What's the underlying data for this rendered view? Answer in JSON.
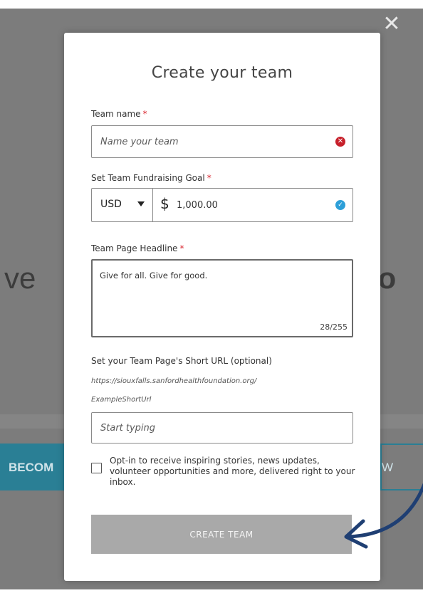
{
  "background": {
    "headline_left": "ve",
    "headline_right": "go",
    "button_left": "BECOM",
    "button_right": "W"
  },
  "modal": {
    "close_symbol": "✕",
    "title": "Create your team",
    "team_name": {
      "label": "Team name",
      "required_marker": "*",
      "placeholder": "Name your team",
      "status_icon": "error-icon",
      "status_symbol": "✕"
    },
    "goal": {
      "label": "Set Team Fundraising Goal",
      "required_marker": "*",
      "currency": "USD",
      "currency_symbol": "$",
      "value": "1,000.00",
      "status_icon": "check-icon",
      "status_symbol": "✓"
    },
    "headline": {
      "label": "Team Page Headline",
      "required_marker": "*",
      "value": "Give for all. Give for good.",
      "char_count": "28/255"
    },
    "short_url": {
      "label": "Set your Team Page's Short URL (optional)",
      "base_url": "https://siouxfalls.sanfordhealthfoundation.org/",
      "example": "ExampleShortUrl",
      "placeholder": "Start typing"
    },
    "optin": {
      "checked": false,
      "text": "Opt-in to receive inspiring stories, news updates, volunteer opportunities and more, delivered right to your inbox."
    },
    "submit_label": "CREATE TEAM"
  },
  "colors": {
    "backdrop": "#7c7c7c",
    "teal": "#2a7f95",
    "error": "#c7202b",
    "valid": "#2d9fd8",
    "button_disabled": "#a9a9a9",
    "arrow": "#1f3f73"
  }
}
